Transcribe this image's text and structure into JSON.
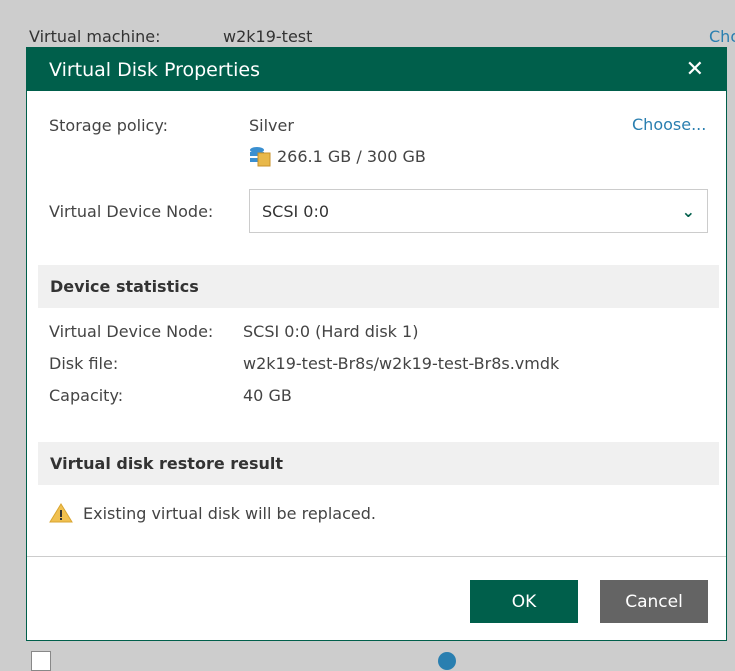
{
  "background": {
    "vm_label": "Virtual machine:",
    "vm_value": "w2k19-test",
    "choose_link": "Cho"
  },
  "dialog": {
    "title": "Virtual Disk Properties",
    "storage_policy_label": "Storage policy:",
    "storage_policy_value": "Silver",
    "storage_capacity": "266.1 GB / 300 GB",
    "choose_link": "Choose...",
    "device_node_label": "Virtual Device Node:",
    "device_node_value": "SCSI 0:0",
    "stats": {
      "title": "Device statistics",
      "rows": [
        {
          "label": "Virtual Device Node:",
          "value": "SCSI 0:0 (Hard disk 1)"
        },
        {
          "label": "Disk file:",
          "value": "w2k19-test-Br8s/w2k19-test-Br8s.vmdk"
        },
        {
          "label": "Capacity:",
          "value": "40 GB"
        }
      ]
    },
    "result": {
      "title": "Virtual disk restore result",
      "message": "Existing virtual disk will be replaced."
    },
    "ok_label": "OK",
    "cancel_label": "Cancel"
  },
  "colors": {
    "accent": "#005f4b",
    "link": "#2a7fb0",
    "cancel": "#646464"
  }
}
